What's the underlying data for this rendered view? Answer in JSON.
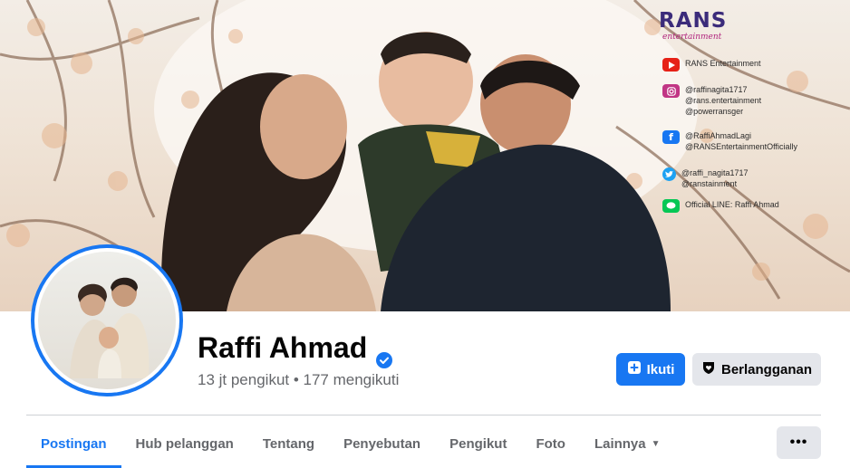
{
  "cover": {
    "brand": {
      "name": "RANS",
      "tagline": "entertainment"
    },
    "social": [
      {
        "icon": "youtube-icon",
        "color": "#e62117",
        "lines": [
          "RANS Entertainment"
        ]
      },
      {
        "icon": "instagram-icon",
        "color": "#c13584",
        "lines": [
          "@raffinagita1717",
          "@rans.entertainment",
          "@powerransger"
        ]
      },
      {
        "icon": "facebook-icon",
        "color": "#1877f2",
        "lines": [
          "@RaffiAhmadLagi",
          "@RANSEntertainmentOfficially"
        ]
      },
      {
        "icon": "twitter-icon",
        "color": "#1da1f2",
        "lines": [
          "@raffi_nagita1717",
          "@ranstainment"
        ]
      },
      {
        "icon": "line-icon",
        "color": "#06c755",
        "lines": [
          "Official LINE: Raffi Ahmad"
        ]
      }
    ]
  },
  "profile": {
    "name": "Raffi Ahmad",
    "stats": "13 jt pengikut • 177 mengikuti"
  },
  "actions": {
    "follow_label": "Ikuti",
    "subscribe_label": "Berlangganan"
  },
  "tabs": [
    {
      "label": "Postingan",
      "active": true
    },
    {
      "label": "Hub pelanggan"
    },
    {
      "label": "Tentang"
    },
    {
      "label": "Penyebutan"
    },
    {
      "label": "Pengikut"
    },
    {
      "label": "Foto"
    },
    {
      "label": "Lainnya",
      "dropdown": true
    }
  ],
  "more_label": "•••",
  "colors": {
    "accent": "#1877f2",
    "secondary_button": "#e4e6eb",
    "muted_text": "#65676b"
  }
}
